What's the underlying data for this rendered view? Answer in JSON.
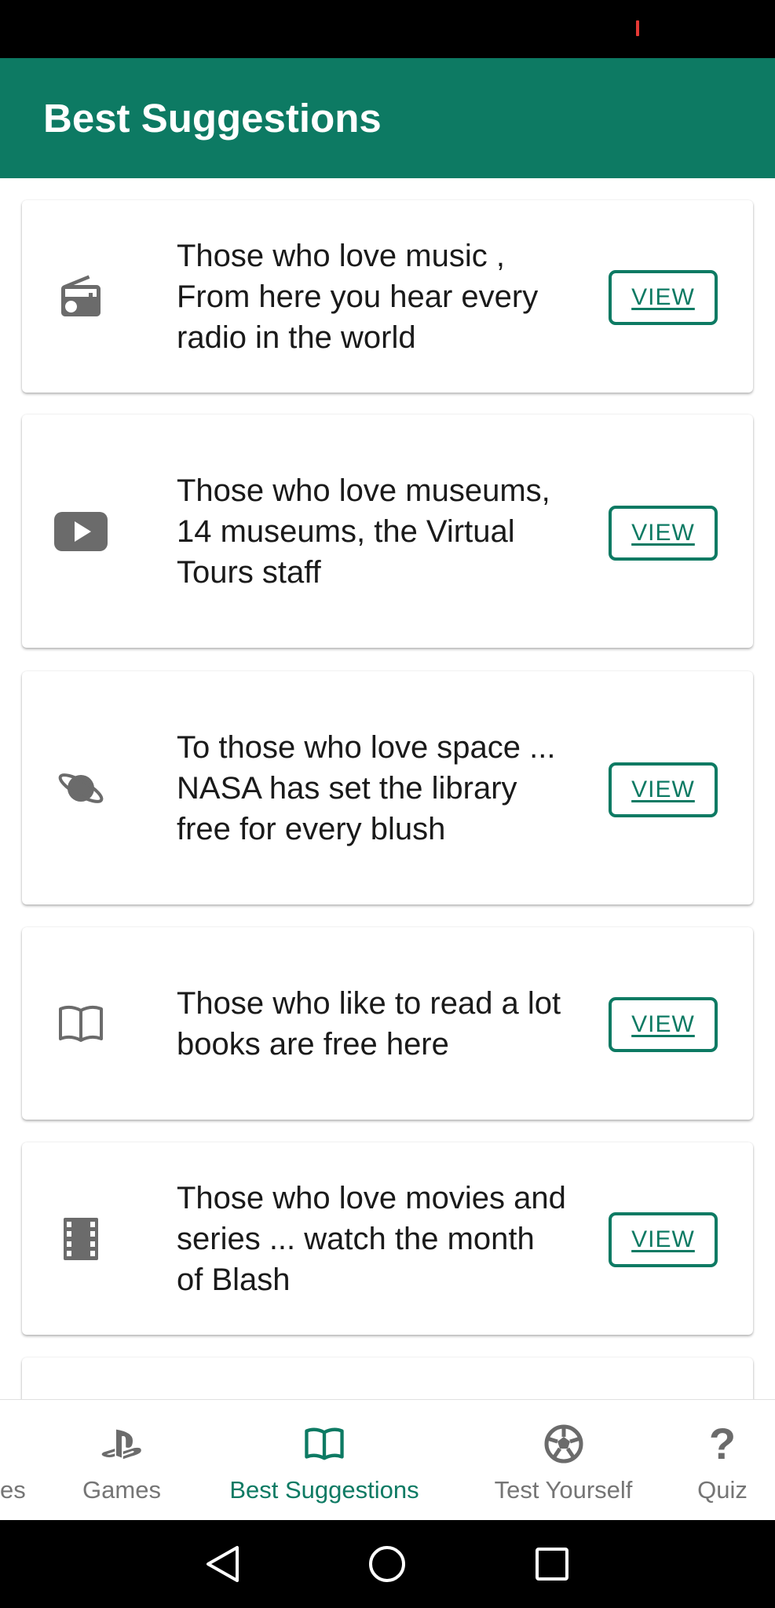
{
  "app_bar": {
    "title": "Best Suggestions"
  },
  "colors": {
    "primary": "#0d7a63",
    "icon_gray": "#6b6b6b",
    "text": "#1a1a1a"
  },
  "cards": [
    {
      "icon": "radio-icon",
      "text": "Those who love music , From here you hear every radio in the world",
      "button": "VIEW"
    },
    {
      "icon": "play-video-icon",
      "text": "Those who love museums, 14 museums, the Virtual Tours staff",
      "button": "VIEW"
    },
    {
      "icon": "planet-icon",
      "text": "To those who love space ... NASA has set the library free for every blush",
      "button": "VIEW"
    },
    {
      "icon": "book-icon",
      "text": "Those who like to read a lot books are free here",
      "button": "VIEW"
    },
    {
      "icon": "film-icon",
      "text": "Those who love movies and series ... watch the month of Blash",
      "button": "VIEW"
    }
  ],
  "bottom_nav": {
    "items": [
      {
        "label": "es",
        "active": false
      },
      {
        "label": "Games",
        "icon": "playstation-icon",
        "active": false
      },
      {
        "label": "Best Suggestions",
        "icon": "book-icon",
        "active": true
      },
      {
        "label": "Test Yourself",
        "icon": "soccer-ball-icon",
        "active": false
      },
      {
        "label": "Quiz",
        "icon": "question-mark-icon",
        "active": false
      }
    ]
  }
}
